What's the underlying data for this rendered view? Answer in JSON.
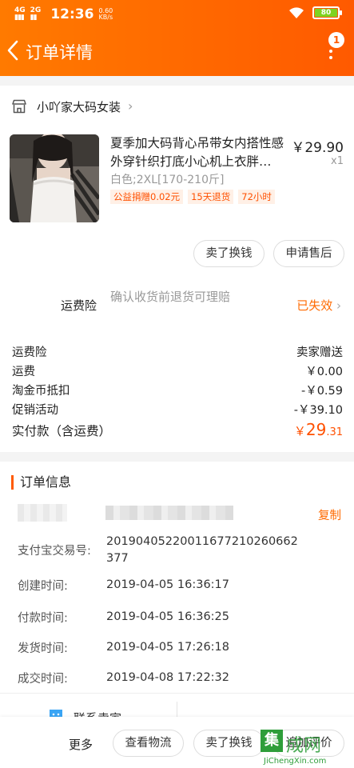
{
  "status_bar": {
    "network_1": "4G",
    "network_2": "2G",
    "time": "12:36",
    "speed": "0.60",
    "speed_unit": "KB/s",
    "battery": "80",
    "battery_color": "#7ed321"
  },
  "header": {
    "title": "订单详情",
    "back_icon": "chevron-left-icon",
    "more_icon": "more-vertical-icon",
    "badge_count": "1",
    "gradient": [
      "#ff7a00",
      "#ff5a00"
    ]
  },
  "shop": {
    "icon": "shop-icon",
    "name": "小吖家大码女装"
  },
  "product": {
    "title": "夏季加大码背心吊带女内搭性感外穿针织打底小心机上衣胖…",
    "price": "￥29.90",
    "qty": "x1",
    "sku": "白色;2XL[170-210斤]",
    "tags": [
      "公益捐赠0.02元",
      "15天退货",
      "72小时"
    ]
  },
  "actions": {
    "exchange": "卖了换钱",
    "after_sale": "申请售后"
  },
  "insurance": {
    "label": "运费险",
    "desc": "确认收货前退货可理赔",
    "status": "已失效",
    "status_color": "#ff6a00"
  },
  "fees": [
    {
      "label": "运费险",
      "value": "卖家赠送"
    },
    {
      "label": "运费",
      "value": "￥0.00"
    },
    {
      "label": "淘金币抵扣",
      "value": "-￥0.59"
    },
    {
      "label": "促销活动",
      "value": "-￥39.10"
    }
  ],
  "total": {
    "label": "实付款（含运费）",
    "currency": "￥",
    "integer": "29",
    "decimal": ".31",
    "color": "#ff5000"
  },
  "order_info": {
    "title": "订单信息",
    "copy": "复制",
    "rows": [
      {
        "key": "支付宝交易号:",
        "value": "20190405220011677210260662377"
      },
      {
        "key": "创建时间:",
        "value": "2019-04-05 16:36:17"
      },
      {
        "key": "付款时间:",
        "value": "2019-04-05 16:36:25"
      },
      {
        "key": "发货时间:",
        "value": "2019-04-05 17:26:18"
      },
      {
        "key": "成交时间:",
        "value": "2019-04-08 17:22:32"
      }
    ]
  },
  "contact": {
    "icon": "chat-icon",
    "label": "联系卖家"
  },
  "bottom_bar": {
    "more": "更多",
    "logistics": "查看物流",
    "exchange": "卖了换钱",
    "review": "追加评价"
  },
  "watermark": {
    "mark": "集",
    "text": "成网",
    "url": "JiChengXin.com"
  }
}
